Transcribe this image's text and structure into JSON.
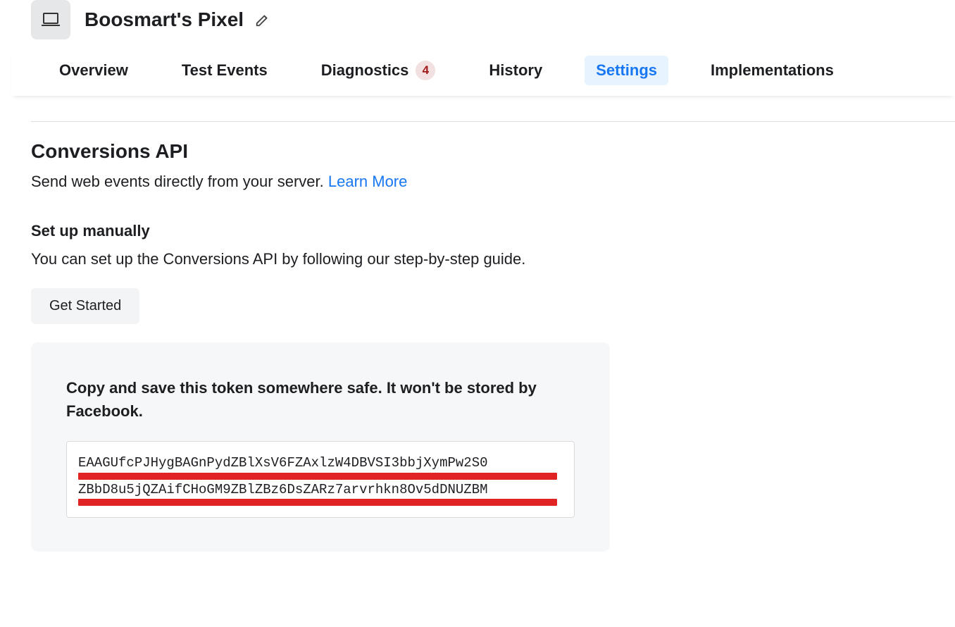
{
  "header": {
    "title": "Boosmart's Pixel"
  },
  "tabs": {
    "overview": "Overview",
    "test_events": "Test Events",
    "diagnostics": "Diagnostics",
    "diagnostics_badge": "4",
    "history": "History",
    "settings": "Settings",
    "implementations": "Implementations"
  },
  "conversions": {
    "title": "Conversions API",
    "desc_prefix": "Send web events directly from your server. ",
    "learn_more": "Learn More",
    "manual_title": "Set up manually",
    "manual_desc": "You can set up the Conversions API by following our step-by-step guide.",
    "get_started": "Get Started",
    "token_heading": "Copy and save this token somewhere safe. It won't be stored by Facebook.",
    "token_line1": "EAAGUfcPJHygBAGnPydZBlXsV6FZAxlzW4DBVSI3bbjXymPw2S0",
    "token_line2": "ZBbD8u5jQZAifCHoGM9ZBlZBz6DsZARz7arvrhkn8Ov5dDNUZBM"
  }
}
